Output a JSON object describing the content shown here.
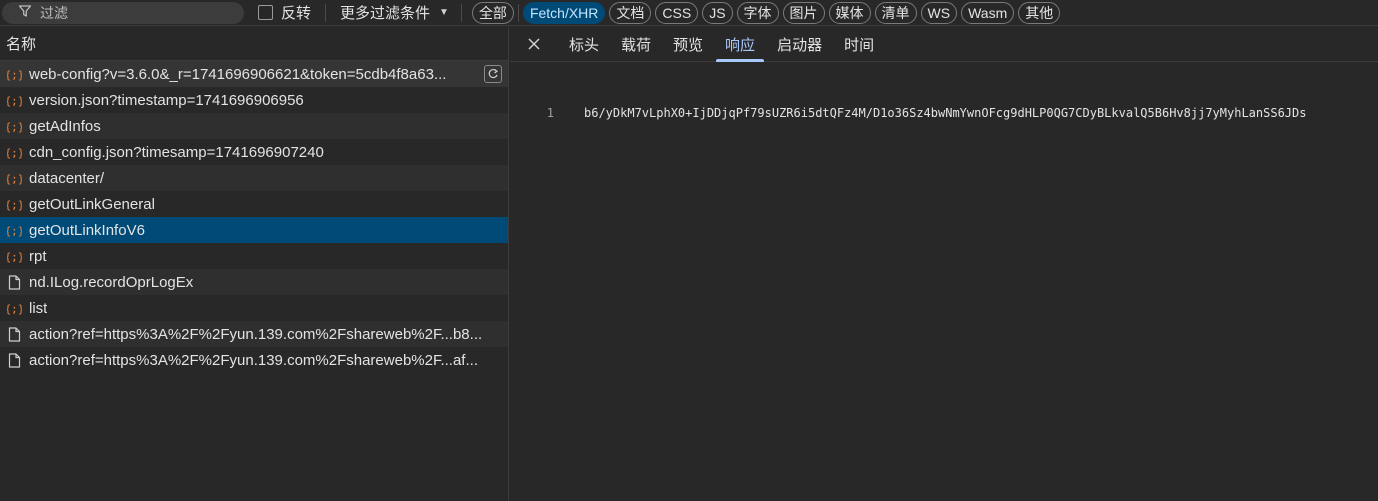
{
  "toolbar": {
    "filter_placeholder": "过滤",
    "invert_label": "反转",
    "more_filters_label": "更多过滤条件",
    "chips": [
      {
        "label": "全部",
        "active": false
      },
      {
        "label": "Fetch/XHR",
        "active": true
      },
      {
        "label": "文档",
        "active": false
      },
      {
        "label": "CSS",
        "active": false
      },
      {
        "label": "JS",
        "active": false
      },
      {
        "label": "字体",
        "active": false
      },
      {
        "label": "图片",
        "active": false
      },
      {
        "label": "媒体",
        "active": false
      },
      {
        "label": "清单",
        "active": false
      },
      {
        "label": "WS",
        "active": false
      },
      {
        "label": "Wasm",
        "active": false
      },
      {
        "label": "其他",
        "active": false
      }
    ]
  },
  "request_list": {
    "column_header": "名称",
    "rows": [
      {
        "name": "web-config?v=3.6.0&_r=1741696906621&token=5cdb4f8a63...",
        "icon": "fetch-icon"
      },
      {
        "name": "version.json?timestamp=1741696906956",
        "icon": "fetch-icon"
      },
      {
        "name": "getAdInfos",
        "icon": "fetch-icon"
      },
      {
        "name": "cdn_config.json?timesamp=1741696907240",
        "icon": "fetch-icon"
      },
      {
        "name": "datacenter/",
        "icon": "fetch-icon"
      },
      {
        "name": "getOutLinkGeneral",
        "icon": "fetch-icon"
      },
      {
        "name": "getOutLinkInfoV6",
        "icon": "fetch-icon"
      },
      {
        "name": "rpt",
        "icon": "fetch-icon"
      },
      {
        "name": "nd.ILog.recordOprLogEx",
        "icon": "document-icon"
      },
      {
        "name": "list",
        "icon": "fetch-icon"
      },
      {
        "name": "action?ref=https%3A%2F%2Fyun.139.com%2Fshareweb%2F...b8...",
        "icon": "document-icon"
      },
      {
        "name": "action?ref=https%3A%2F%2Fyun.139.com%2Fshareweb%2F...af...",
        "icon": "document-icon"
      }
    ],
    "selected_index": 6
  },
  "detail": {
    "tabs": [
      "标头",
      "载荷",
      "预览",
      "响应",
      "启动器",
      "时间"
    ],
    "active_tab": 3,
    "response_lines": [
      {
        "number": "1",
        "text": "b6/yDkM7vLphX0+IjDDjqPf79sUZR6i5dtQFz4M/D1o36Sz4bwNmYwnOFcg9dHLP0QG7CDyBLkvalQ5B6Hv8jj7yMyhLanSS6JDs"
      }
    ]
  },
  "colors": {
    "background": "#282828",
    "selected_row": "#004a77",
    "active_chip": "#004a77",
    "active_tab": "#a8c7fa",
    "fetch_icon": "#e8833a"
  }
}
